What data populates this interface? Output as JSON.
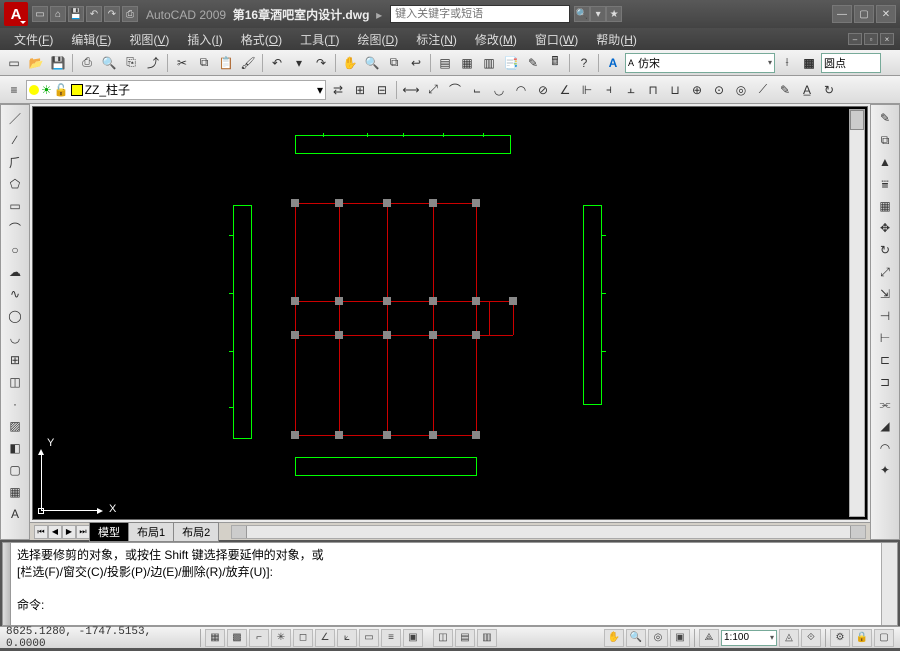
{
  "app": {
    "name": "AutoCAD 2009",
    "filename": "第16章酒吧室内设计.dwg",
    "logo_letter": "A"
  },
  "search": {
    "placeholder": "键入关键字或短语"
  },
  "menu": {
    "items": [
      {
        "label": "文件",
        "accel": "F"
      },
      {
        "label": "编辑",
        "accel": "E"
      },
      {
        "label": "视图",
        "accel": "V"
      },
      {
        "label": "插入",
        "accel": "I"
      },
      {
        "label": "格式",
        "accel": "O"
      },
      {
        "label": "工具",
        "accel": "T"
      },
      {
        "label": "绘图",
        "accel": "D"
      },
      {
        "label": "标注",
        "accel": "N"
      },
      {
        "label": "修改",
        "accel": "M"
      },
      {
        "label": "窗口",
        "accel": "W"
      },
      {
        "label": "帮助",
        "accel": "H"
      }
    ]
  },
  "std_toolbar": {
    "text_style": "仿宋",
    "textstyle_icon": "A",
    "dimstyle": "圆点"
  },
  "layer": {
    "current": "ZZ_柱子"
  },
  "ucs": {
    "x": "X",
    "y": "Y"
  },
  "tabs": {
    "model": "模型",
    "layout1": "布局1",
    "layout2": "布局2"
  },
  "command": {
    "line1": "选择要修剪的对象，或按住 Shift 键选择要延伸的对象，或",
    "line2": "[栏选(F)/窗交(C)/投影(P)/边(E)/删除(R)/放弃(U)]:",
    "prompt": "命令:"
  },
  "status": {
    "coords": "8625.1280, -1747.5153, 0.0000",
    "scale": "1:100"
  }
}
